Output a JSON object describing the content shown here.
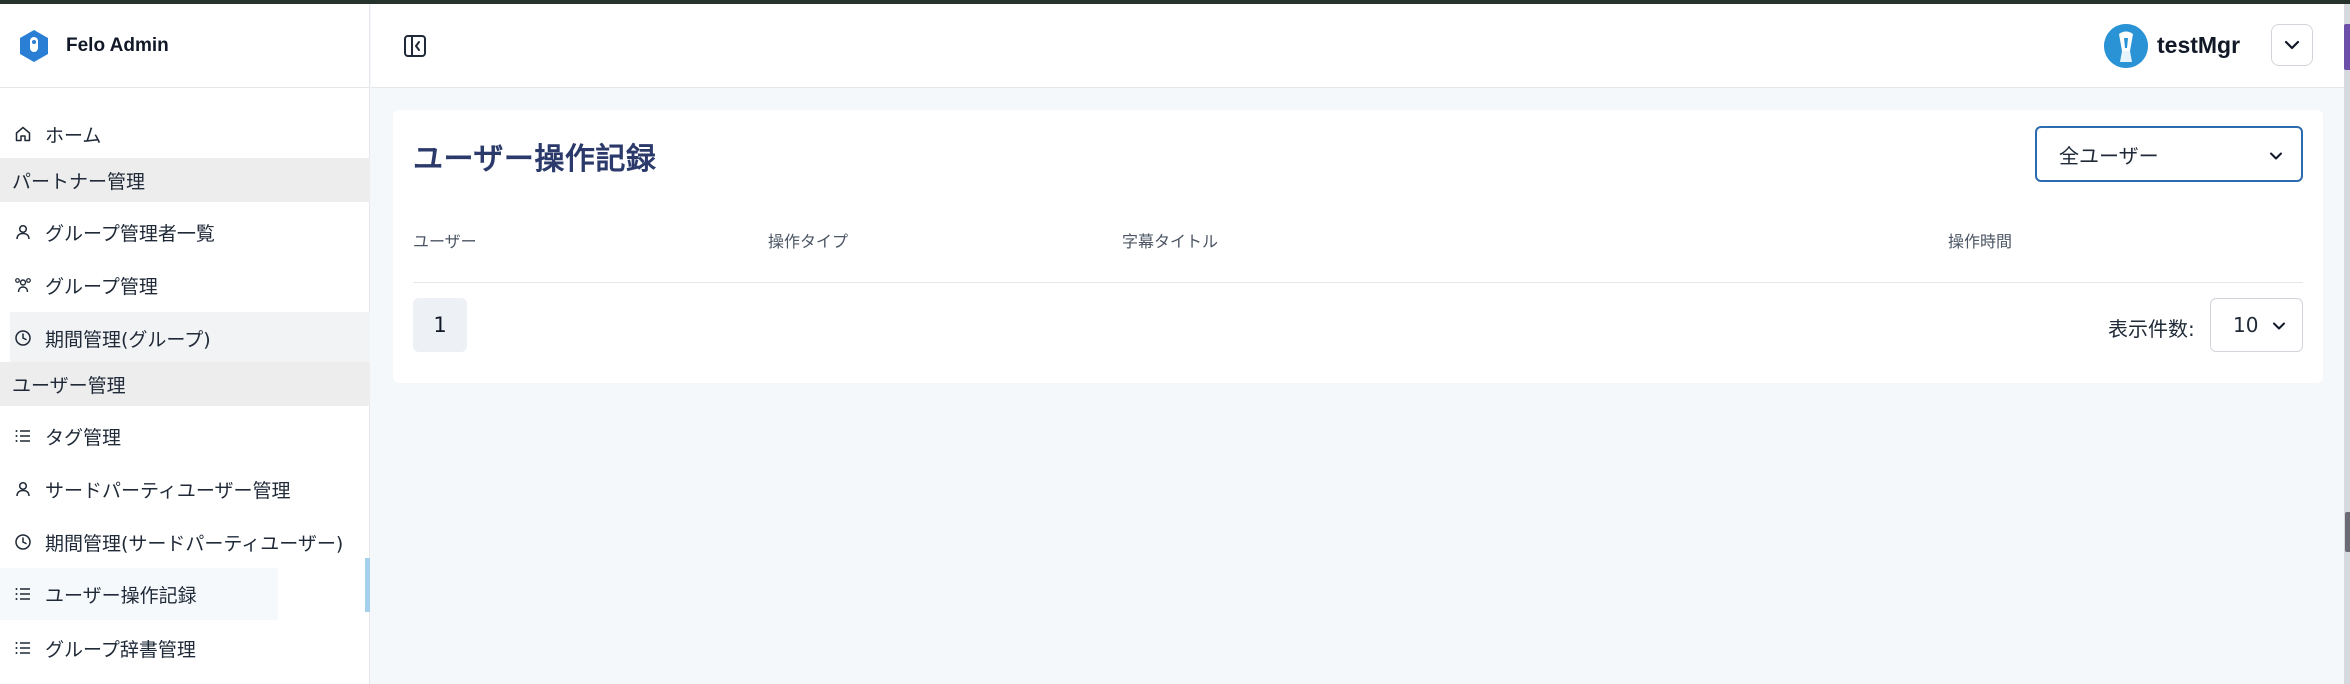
{
  "app": {
    "title": "Felo Admin"
  },
  "sidebar": {
    "home": "ホーム",
    "section_partner": "パートナー管理",
    "group_admin_list": "グループ管理者一覧",
    "group_management": "グループ管理",
    "period_group": "期間管理(グループ)",
    "section_user": "ユーザー管理",
    "tag_management": "タグ管理",
    "third_party_user": "サードパーティユーザー管理",
    "period_third_party": "期間管理(サードパーティユーザー)",
    "user_activity_log": "ユーザー操作記録",
    "group_dictionary": "グループ辞書管理"
  },
  "header": {
    "username": "testMgr"
  },
  "main": {
    "page_title": "ユーザー操作記録",
    "user_filter": {
      "selected": "全ユーザー"
    },
    "table": {
      "columns": [
        "ユーザー",
        "操作タイプ",
        "字幕タイトル",
        "操作時間"
      ],
      "rows": []
    },
    "pagination": {
      "current_page": "1",
      "per_page_label": "表示件数:",
      "per_page_value": "10"
    }
  },
  "colors": {
    "title": "#2b3a6b",
    "select_border": "#2b6cb0",
    "active_indicator": "#a4d0ec",
    "brand": "#2a93d5"
  }
}
